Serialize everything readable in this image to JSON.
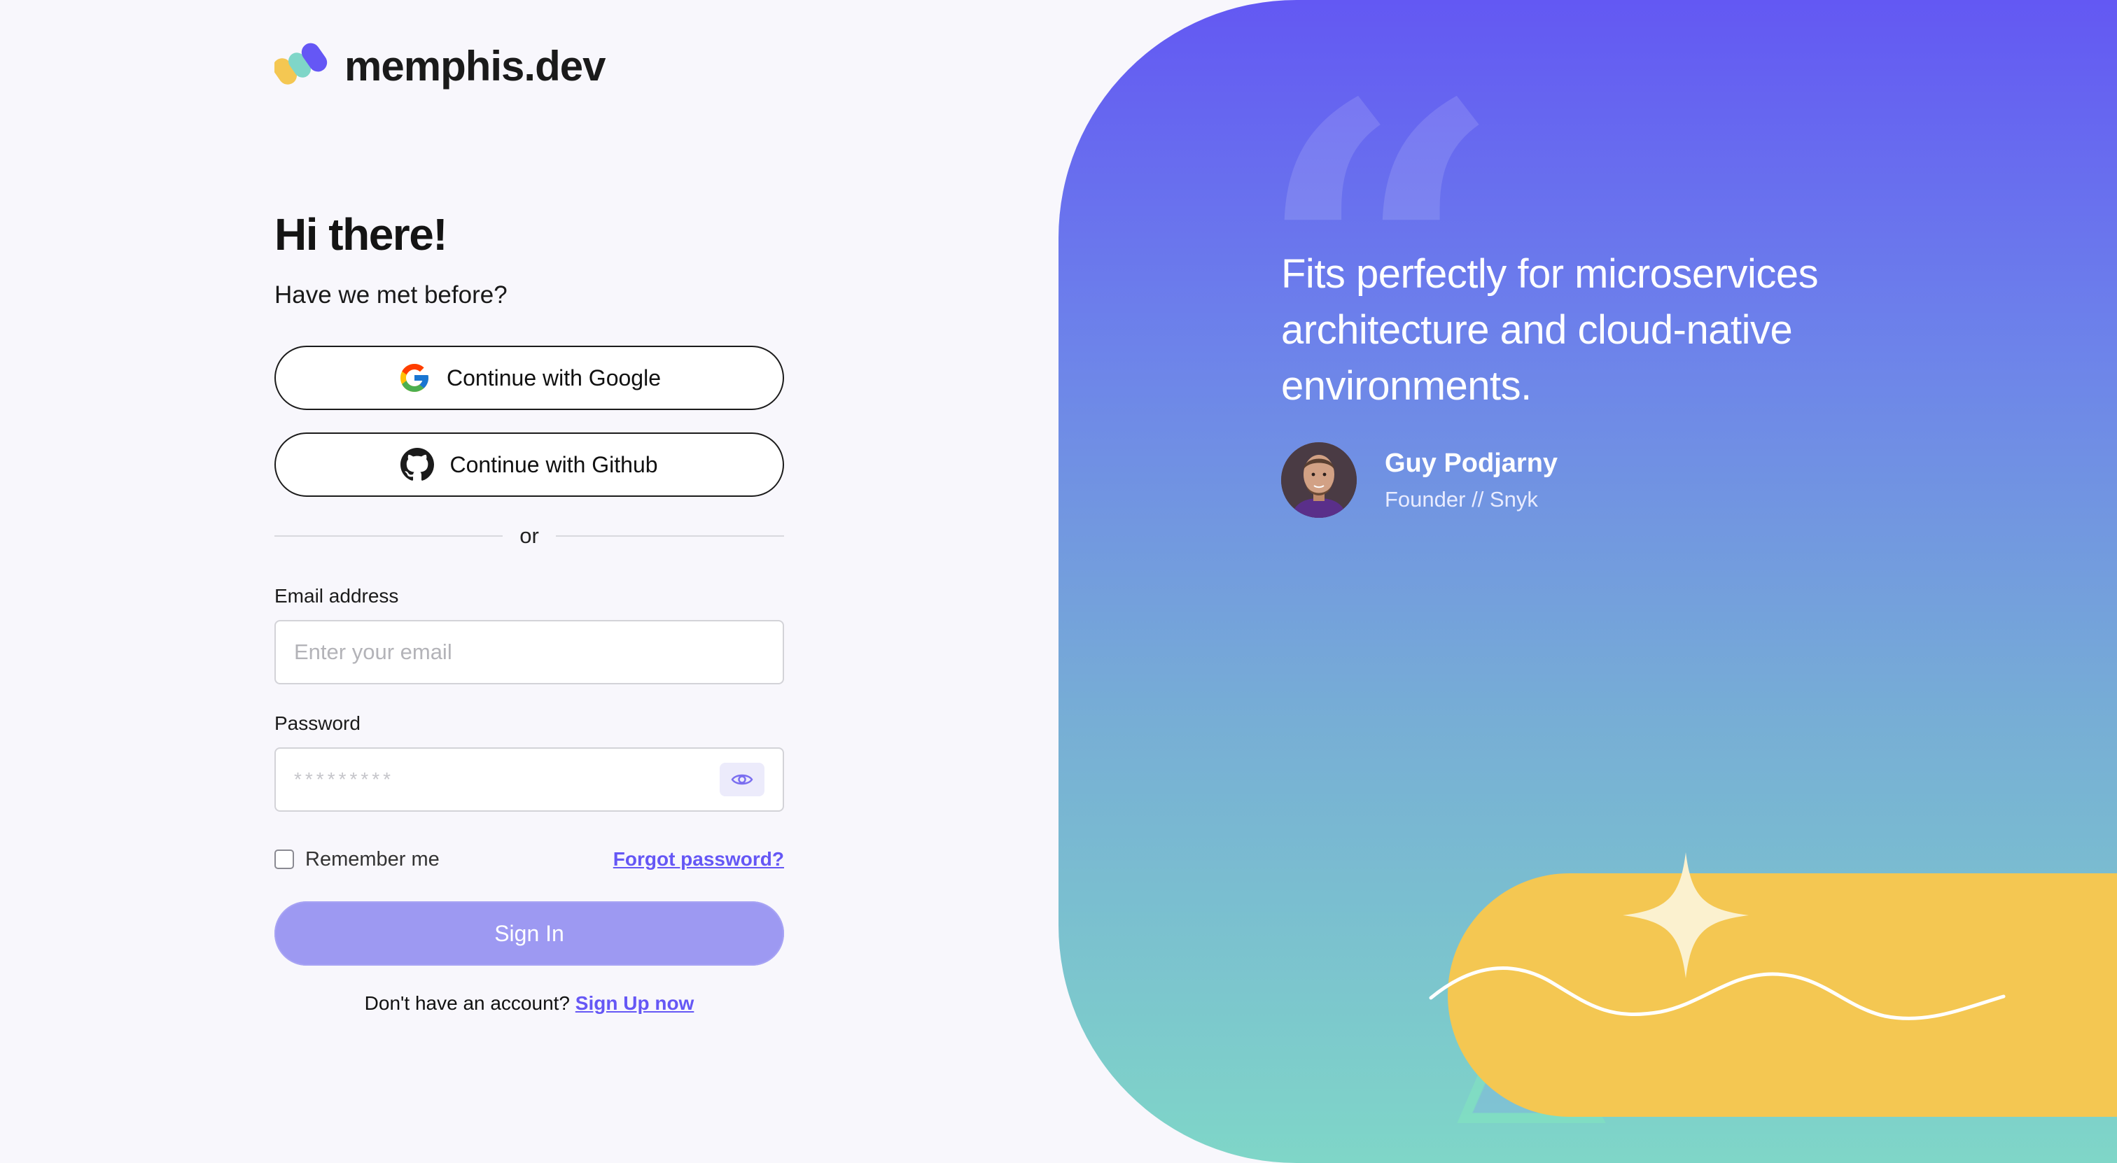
{
  "brand": {
    "name": "memphis.dev"
  },
  "login": {
    "title": "Hi there!",
    "subtitle": "Have we met before?",
    "google_label": "Continue with Google",
    "github_label": "Continue with Github",
    "divider_text": "or",
    "email": {
      "label": "Email address",
      "placeholder": "Enter your email",
      "value": ""
    },
    "password": {
      "label": "Password",
      "masked_value": "*********"
    },
    "remember_label": "Remember me",
    "remember_checked": false,
    "forgot_label": "Forgot password?",
    "signin_label": "Sign In",
    "signup_prompt": "Don't have an account?",
    "signup_link": "Sign Up now"
  },
  "testimonial": {
    "quote": "Fits perfectly for microservices architecture and cloud-native environments.",
    "author_name": "Guy Podjarny",
    "author_role": "Founder // Snyk"
  },
  "icons": [
    "memphis-logo-icon",
    "google-icon",
    "github-icon",
    "eye-icon",
    "quote-icon",
    "avatar-photo"
  ],
  "colors": {
    "accent": "#6557f5",
    "signin_button": "#9d99f2",
    "hero_top": "#6358f3",
    "hero_bottom": "#7fd6c8",
    "decor_yellow": "#f4c752",
    "decor_star": "#fbf1cf"
  }
}
